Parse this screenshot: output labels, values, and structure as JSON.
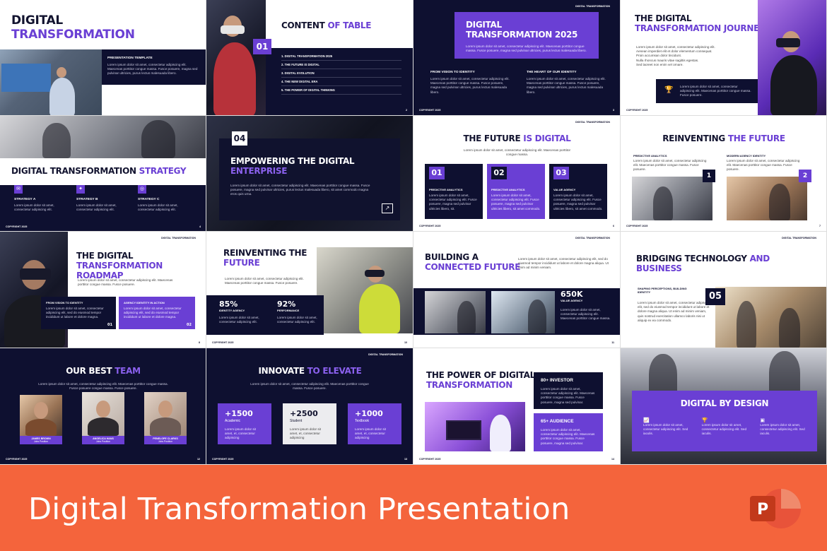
{
  "banner": {
    "title": "Digital Transformation Presentation",
    "app_icon": "powerpoint-icon",
    "color": "#f4643c"
  },
  "theme": {
    "dark": "#0e1030",
    "accent": "#6a3fd4"
  },
  "common": {
    "brand": "DIGITAL TRANSFORMATION",
    "footer": "COPYRIGHT 2025"
  },
  "s1": {
    "title_a": "DIGITAL",
    "title_b": "TRANSFORMATION",
    "subtitle": "PRESENTATION TEMPLATE",
    "body": "Lorem ipsum dolor sit amet, consectetur adipiscing elit. Maecenas porttitor congue massa. Fusce posuere, magna sed pulvinar ultricies, purus lectus malesuada libero."
  },
  "s2": {
    "title_a": "CONTENT",
    "title_b": "OF TABLE",
    "badge": "01",
    "items": [
      "1. DIGITAL TRANSFORMATION 2025",
      "2. THE FUTURE IS DIGITAL",
      "3. DIGITAL EVOLUTION",
      "4. THE NEW DIGITAL ERA",
      "5. THE POWER OF DIGITAL THINKING"
    ],
    "page": "2"
  },
  "s3": {
    "title": "DIGITAL TRANSFORMATION 2025",
    "intro": "Lorem ipsum dolor sit amet, consectetur adipiscing elit. Maecenas porttitor congue massa. Fusce posuere, magna sed pulvinar ultricies, purus lectus malesuada libero.",
    "col1": "FROM VISION TO IDENTITY",
    "col2": "THE HEART OF OUR IDENTITY",
    "body": "Lorem ipsum dolor sit amet, consectetur adipiscing elit. Maecenas porttitor congue massa. Fusce posuere, magna sed pulvinar ultricies, purus lectus malesuada libero.",
    "page": "3"
  },
  "s4": {
    "title_a": "THE DIGITAL",
    "title_b": "TRANSFORMATION JOURNEY",
    "bullets": [
      "Lorem ipsum dolor sit amet, consectetur adipiscing elit.",
      "Aenean imperdiet elit et dolor elementum consequat.",
      "Proin accumsan dolor tincidunt.",
      "Nulla rhoncus mauris vitae sagittis egestas.",
      "Sed laoreet non enim vel ornare."
    ],
    "box": "Lorem ipsum dolor sit amet, consectetur adipiscing elit. Maecenas porttitor congue massa. Fusce posuere."
  },
  "s5": {
    "title_a": "DIGITAL TRANSFORMATION",
    "title_b": "STRATEGY",
    "items": [
      {
        "label": "STRATEGY A",
        "text": "Lorem ipsum dolor sit amet, consectetur adipiscing elit."
      },
      {
        "label": "STRATEGY B",
        "text": "Lorem ipsum dolor sit amet, consectetur adipiscing elit."
      },
      {
        "label": "STRATEGY C",
        "text": "Lorem ipsum dolor sit amet, consectetur adipiscing elit."
      }
    ],
    "page": "4"
  },
  "s6": {
    "badge": "04",
    "title_a": "EMPOWERING THE DIGITAL",
    "title_b": "ENTERPRISE",
    "body": "Lorem ipsum dolor sit amet, consectetur adipiscing elit. Maecenas porttitor congue massa. Fusce posuere, magna sed pulvinar ultricies, purus lectus malesuada libero, sit amet commodo magna eros quis urna."
  },
  "s7": {
    "title_a": "THE FUTURE",
    "title_b": "IS DIGITAL",
    "intro": "Lorem ipsum dolor sit amet, consectetur adipiscing elit. Maecenas porttitor congue massa.",
    "cards": [
      {
        "num": "01",
        "label": "PREDICTIVE ANALYTICS",
        "text": "Lorem ipsum dolor sit amet, consectetur adipiscing elit. Fusce posuere, magna sed pulvinar ultricies libero, sit."
      },
      {
        "num": "02",
        "label": "PREDICTIVE ANALYTICS",
        "text": "Lorem ipsum dolor sit amet, consectetur adipiscing elit. Fusce posuere, magna sed pulvinar ultricies libero, sit amet commodo."
      },
      {
        "num": "03",
        "label": "VALUE AGENCY",
        "text": "Lorem ipsum dolor sit amet, consectetur adipiscing elit. Fusce posuere, magna sed pulvinar ultricies libero, sit amet commodo."
      }
    ],
    "page": "6"
  },
  "s8": {
    "title_a": "REINVENTING",
    "title_b": "THE FUTURE",
    "col1": "PREDICTIVE ANALYTICS",
    "col2": "MODERN AGENCY IDENTITY",
    "text": "Lorem ipsum dolor sit amet, consectetur adipiscing elit. Maecenas porttitor congue massa. Fusce posuere.",
    "badge1": "1",
    "badge2": "2",
    "page": "7"
  },
  "s9": {
    "title_a": "THE DIGITAL",
    "title_b": "TRANSFORMATION ROADMAP",
    "intro": "Lorem ipsum dolor sit amet, consectetur adipiscing elit. Maecenas porttitor congue massa. Fusce posuere.",
    "card1": "FROM VISION TO IDENTITY",
    "card2": "AGENCY IDENTITY IN ACTION",
    "text": "Lorem ipsum dolor sit amet, consectetur adipiscing elit, sed do eiusmod tempor incididunt ut labore et dolore magna.",
    "n1": "01",
    "n2": "02",
    "page": "8"
  },
  "s10": {
    "title_a": "REINVENTING THE",
    "title_b": "FUTURE",
    "intro": "Lorem ipsum dolor sit amet, consectetur adipiscing elit. Maecenas porttitor congue massa. Fusce posuere.",
    "stats": [
      {
        "value": "85%",
        "label": "IDENTITY AGENCY",
        "text": "Lorem ipsum dolor sit amet, consectetur adipiscing elit."
      },
      {
        "value": "92%",
        "label": "PERFORMANCE",
        "text": "Lorem ipsum dolor sit amet, consectetur adipiscing elit."
      }
    ],
    "page": "10"
  },
  "s11": {
    "title_a": "BUILDING A",
    "title_b": "CONNECTED FUTURE",
    "intro": "Lorem ipsum dolor sit amet, consectetur adipiscing elit, sed do eiusmod tempor incididunt ut labore et dolore magna aliqua. Ut enim ad minim veniam.",
    "stat": "650K",
    "stat_label": "VALUE AGENCY",
    "stat_text": "Lorem ipsum dolor sit amet, consectetur adipiscing elit. Maecenas porttitor congue massa.",
    "page": "11"
  },
  "s12": {
    "title_a": "BRIDGING TECHNOLOGY",
    "title_b": "AND",
    "title_c": "BUSINESS",
    "sub": "SHAPING PERCEPTIONS, BUILDING IDENTITY",
    "body": "Lorem ipsum dolor sit amet, consectetur adipiscing elit, sed do eiusmod tempor incididunt ut labore et dolore magna aliqua. Ut enim ad minim veniam, quis nostrud exercitation ullamco laboris nisi ut aliquip ex ea commodo.",
    "badge": "05"
  },
  "s13": {
    "title_a": "OUR BEST",
    "title_b": "TEAM",
    "intro": "Lorem ipsum dolor sit amet, consectetur adipiscing elit. Maecenas porttitor congue massa. Fusce posuere congue massa. Fusce posuere.",
    "team": [
      {
        "name": "JAMES BROWN",
        "role": "Jobs Position"
      },
      {
        "name": "ANGELICA HANS",
        "role": "Jobs Position"
      },
      {
        "name": "PENELOPE CLARKS",
        "role": "Jobs Position"
      }
    ],
    "page": "12"
  },
  "s14": {
    "title_a": "INNOVATE",
    "title_b": "TO ELEVATE",
    "intro": "Lorem ipsum dolor sit amet, consectetur adipiscing elit. Maecenas porttitor congue massa. Fusce posuere.",
    "stats": [
      {
        "value": "+1500",
        "label": "Academic",
        "text": "Lorem ipsum dolor sit amet, et, consectetur adipiscing"
      },
      {
        "value": "+2500",
        "label": "Student",
        "text": "Lorem ipsum dolor sit amet, et, consectetur adipiscing"
      },
      {
        "value": "+1000",
        "label": "Textbook",
        "text": "Lorem ipsum dolor sit amet, et, consectetur adipiscing"
      }
    ],
    "page": "13"
  },
  "s15": {
    "title_a": "THE POWER OF DIGITAL",
    "title_b": "TRANSFORMATION",
    "stat1": "80+ INVESTOR",
    "stat2": "65+ AUDIENCE",
    "text": "Lorem ipsum dolor sit amet, consectetur adipiscing elit. Maecenas porttitor congue massa. Fusce posuere, magna sed pulvinar.",
    "page": "14"
  },
  "s16": {
    "title": "DIGITAL BY DESIGN",
    "text": "Lorem ipsum dolor sit amet, consectetur adipiscing elit. Sed iaculis."
  }
}
